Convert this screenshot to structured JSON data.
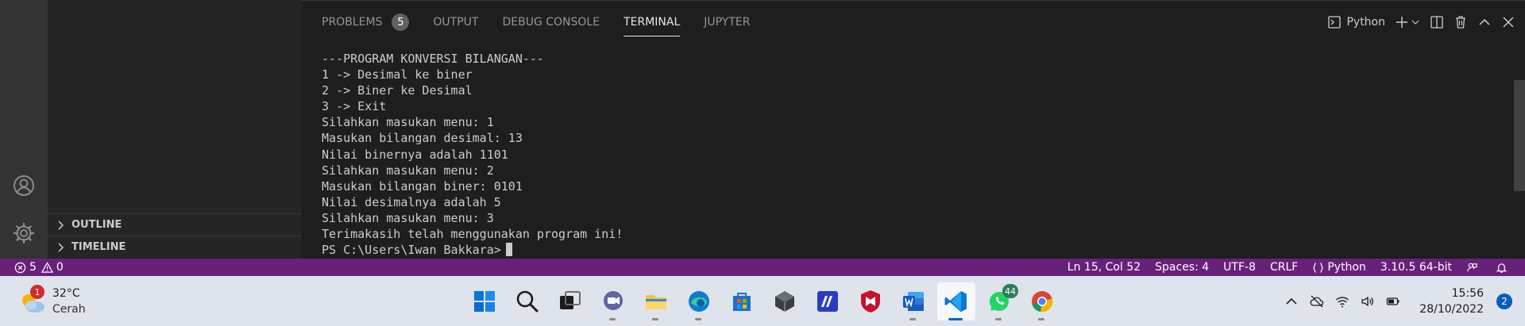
{
  "sidebar": {
    "sections": [
      {
        "label": "OUTLINE"
      },
      {
        "label": "TIMELINE"
      }
    ]
  },
  "panel": {
    "tabs": [
      {
        "label": "PROBLEMS",
        "badge": "5"
      },
      {
        "label": "OUTPUT"
      },
      {
        "label": "DEBUG CONSOLE"
      },
      {
        "label": "TERMINAL",
        "active": true
      },
      {
        "label": "JUPYTER"
      }
    ],
    "terminal_profile": "Python",
    "terminal_lines": [
      "---PROGRAM KONVERSI BILANGAN---",
      "1 -> Desimal ke biner",
      "2 -> Biner ke Desimal",
      "3 -> Exit",
      "Silahkan masukan menu: 1",
      "Masukan bilangan desimal: 13",
      "Nilai binernya adalah 1101",
      "Silahkan masukan menu: 2",
      "Masukan bilangan biner: 0101",
      "Nilai desimalnya adalah 5",
      "Silahkan masukan menu: 3",
      "Terimakasih telah menggunakan program ini!"
    ],
    "prompt": "PS C:\\Users\\Iwan Bakkara>"
  },
  "statusbar": {
    "errors": "5",
    "warnings": "0",
    "position": "Ln 15, Col 52",
    "spaces": "Spaces: 4",
    "encoding": "UTF-8",
    "eol": "CRLF",
    "language": "Python",
    "interpreter": "3.10.5 64-bit",
    "color": "#68217a"
  },
  "taskbar": {
    "weather": {
      "badge": "1",
      "temp": "32°C",
      "condition": "Cerah"
    },
    "apps": [
      {
        "name": "windows-start-icon"
      },
      {
        "name": "search-icon"
      },
      {
        "name": "task-view-icon"
      },
      {
        "name": "teams-chat-icon"
      },
      {
        "name": "file-explorer-icon"
      },
      {
        "name": "edge-icon"
      },
      {
        "name": "microsoft-store-icon"
      },
      {
        "name": "cube-app-icon"
      },
      {
        "name": "app-m-icon"
      },
      {
        "name": "mcafee-icon"
      },
      {
        "name": "word-icon"
      },
      {
        "name": "vscode-icon",
        "active": true
      },
      {
        "name": "whatsapp-icon",
        "badge": "44"
      },
      {
        "name": "chrome-icon"
      }
    ],
    "clock": {
      "time": "15:56",
      "date": "28/10/2022"
    },
    "notifications": "2"
  }
}
